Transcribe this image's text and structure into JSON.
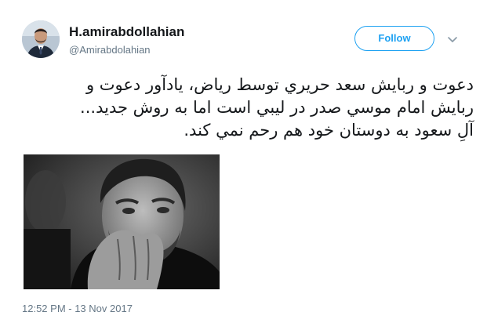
{
  "author": {
    "name": "H.amirabdollahian",
    "handle": "@Amirabdolahian",
    "avatar_icon": "profile-avatar"
  },
  "actions": {
    "follow_label": "Follow",
    "menu_icon": "chevron-down-icon"
  },
  "tweet": {
    "lines": [
      "دعوت و ربايش سعد حريري توسط رياض، يادآور دعوت و",
      "ربايش امام موسي صدر در ليبي است اما به روش جديد...",
      "آلِ سعود به دوستان خود هم رحم نمي كند."
    ],
    "timestamp": "12:52 PM - 13 Nov 2017"
  },
  "colors": {
    "accent": "#1da1f2",
    "secondary_text": "#657786",
    "primary_text": "#14171a"
  }
}
